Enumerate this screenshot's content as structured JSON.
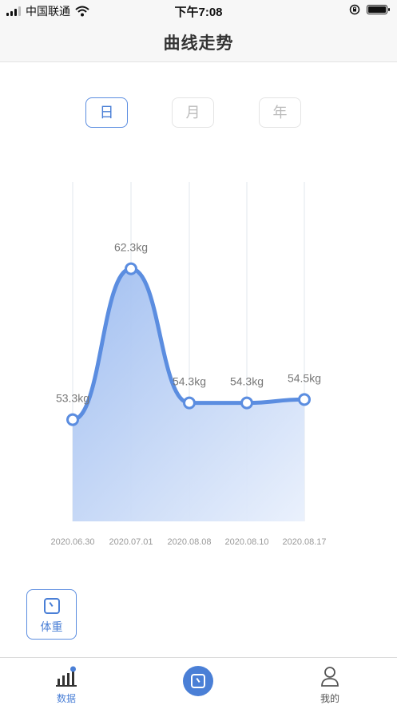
{
  "status_bar": {
    "carrier": "中国联通",
    "time": "下午7:08"
  },
  "header": {
    "title": "曲线走势"
  },
  "period_tabs": [
    {
      "label": "日",
      "active": true
    },
    {
      "label": "月",
      "active": false
    },
    {
      "label": "年",
      "active": false
    }
  ],
  "chart_data": {
    "type": "area",
    "categories": [
      "2020.06.30",
      "2020.07.01",
      "2020.08.08",
      "2020.08.10",
      "2020.08.17"
    ],
    "values": [
      53.3,
      62.3,
      54.3,
      54.3,
      54.5
    ],
    "data_labels": [
      "53.3kg",
      "62.3kg",
      "54.3kg",
      "54.3kg",
      "54.5kg"
    ],
    "unit": "kg",
    "grid": "vertical",
    "colors": {
      "line": "#5b8de0",
      "fill_top": "#9dbcf0",
      "fill_bottom": "#e6eefb"
    }
  },
  "metric_button": {
    "label": "体重",
    "icon": "scale-icon"
  },
  "bottom_nav": {
    "items": [
      {
        "label": "数据",
        "icon": "bar-chart-icon",
        "active": true
      },
      {
        "label": "",
        "icon": "scale-icon",
        "active": false
      },
      {
        "label": "我的",
        "icon": "user-icon",
        "active": false
      }
    ]
  },
  "colors": {
    "accent": "#4a7fd6"
  }
}
